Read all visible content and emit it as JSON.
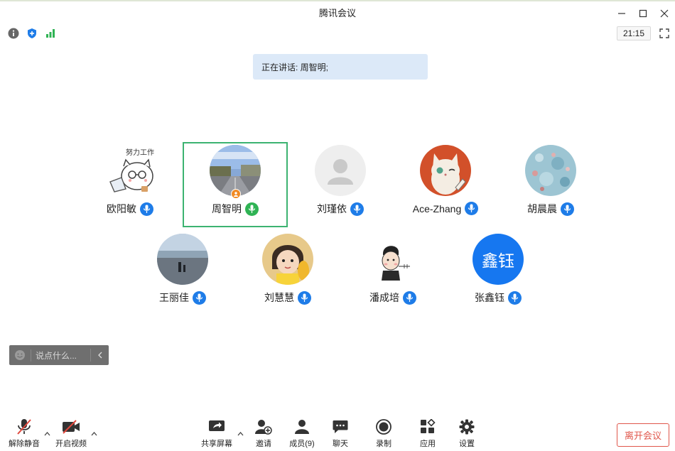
{
  "window": {
    "title": "腾讯会议"
  },
  "infobar": {
    "time": "21:15"
  },
  "speaking": {
    "label": "正在讲话: 周智明;"
  },
  "participants": [
    {
      "name": "欧阳敏",
      "mic": "on",
      "avatar": "cartoon-cat-working-avatar",
      "avatar_caption": "努力工作"
    },
    {
      "name": "周智明",
      "mic": "speaking",
      "avatar": "street-photo-avatar",
      "host": true,
      "active": true
    },
    {
      "name": "刘瑾依",
      "mic": "on",
      "avatar": "default-person-avatar"
    },
    {
      "name": "Ace-Zhang",
      "mic": "on",
      "avatar": "cartoon-cat-avatar"
    },
    {
      "name": "胡晨晨",
      "mic": "on",
      "avatar": "blue-pattern-avatar"
    },
    {
      "name": "王丽佳",
      "mic": "on",
      "avatar": "beach-photo-avatar"
    },
    {
      "name": "刘慧慧",
      "mic": "on",
      "avatar": "child-photo-avatar"
    },
    {
      "name": "潘成培",
      "mic": "on",
      "avatar": "cartoon-man-avatar"
    },
    {
      "name": "张鑫钰",
      "mic": "on",
      "avatar": "text-avatar",
      "avatar_text": "鑫钰"
    }
  ],
  "chat": {
    "placeholder": "说点什么..."
  },
  "toolbar": {
    "unmute": "解除静音",
    "start_video": "开启视频",
    "share_screen": "共享屏幕",
    "invite": "邀请",
    "members": "成员(9)",
    "chat": "聊天",
    "record": "录制",
    "apps": "应用",
    "settings": "设置",
    "leave": "离开会议"
  },
  "colors": {
    "accent": "#1e7ce8",
    "speaking": "#2fb354",
    "active_border": "#3cb371",
    "leave": "#e0564b",
    "banner": "#dce9f8"
  }
}
